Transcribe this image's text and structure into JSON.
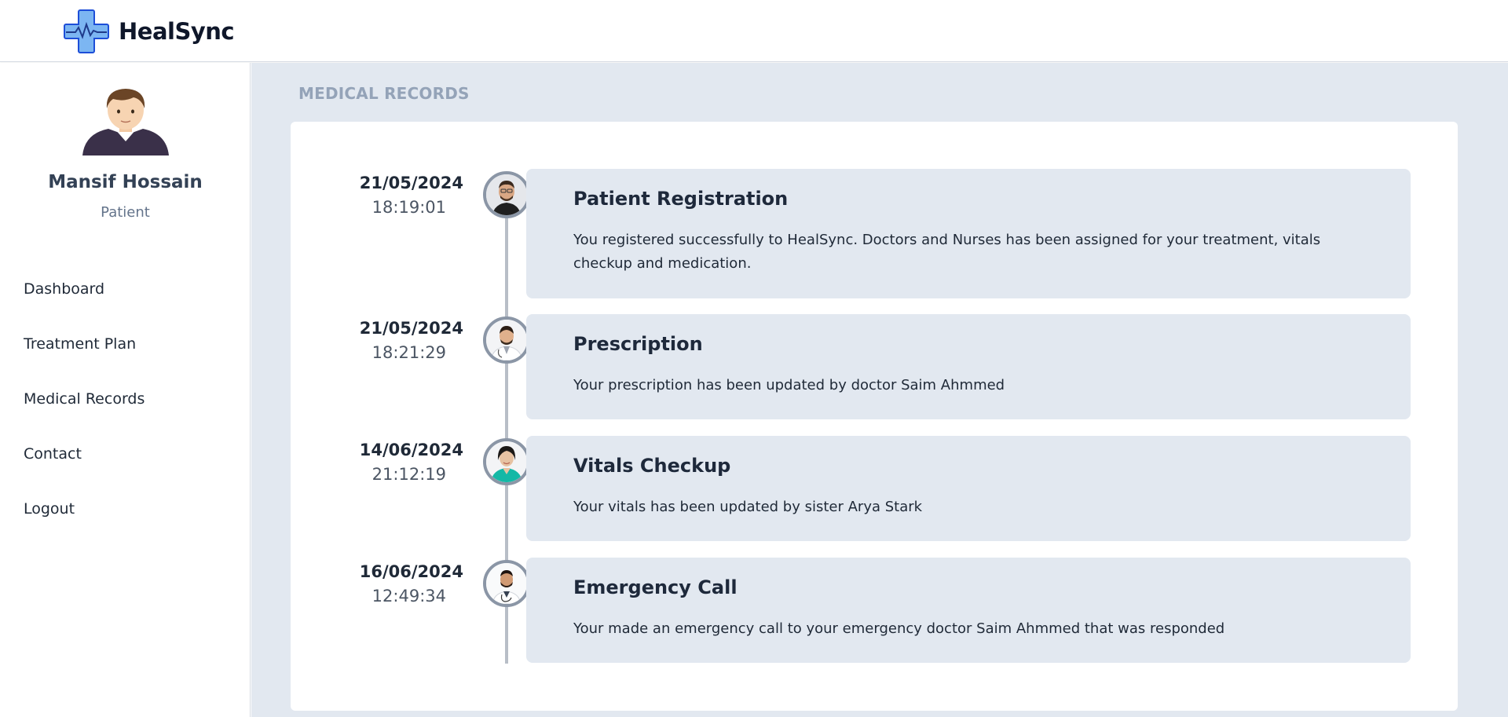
{
  "app": {
    "name": "HealSync"
  },
  "sidebar": {
    "user": {
      "name": "Mansif Hossain",
      "role": "Patient"
    },
    "items": [
      {
        "label": "Dashboard"
      },
      {
        "label": "Treatment Plan"
      },
      {
        "label": "Medical Records"
      },
      {
        "label": "Contact"
      },
      {
        "label": "Logout"
      }
    ]
  },
  "main": {
    "section_title": "MEDICAL RECORDS",
    "records": [
      {
        "date": "21/05/2024",
        "time": "18:19:01",
        "title": "Patient Registration",
        "description": "You registered successfully to HealSync. Doctors and Nurses has been assigned for your treatment, vitals checkup and medication.",
        "avatar_icon": "patient-avatar-icon"
      },
      {
        "date": "21/05/2024",
        "time": "18:21:29",
        "title": "Prescription",
        "description": "Your prescription has been updated by doctor Saim Ahmmed",
        "avatar_icon": "doctor-avatar-icon"
      },
      {
        "date": "14/06/2024",
        "time": "21:12:19",
        "title": "Vitals Checkup",
        "description": "Your vitals has been updated by sister Arya Stark",
        "avatar_icon": "nurse-avatar-icon"
      },
      {
        "date": "16/06/2024",
        "time": "12:49:34",
        "title": "Emergency Call",
        "description": "Your made an emergency call to your emergency doctor Saim Ahmmed that was responded",
        "avatar_icon": "doctor-avatar-icon"
      }
    ]
  },
  "colors": {
    "main_bg": "#e2e8f0",
    "card_bg": "#ffffff",
    "logo_accent": "#3b82f6",
    "timeline": "#b8bec7"
  }
}
